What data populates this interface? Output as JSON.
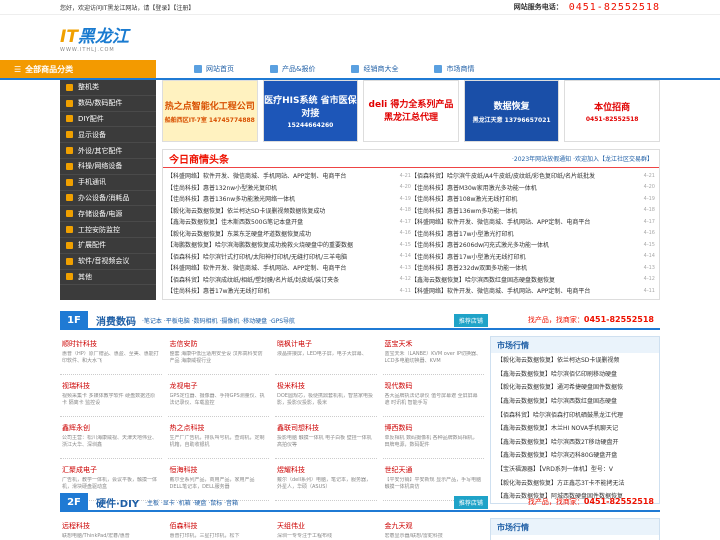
{
  "topbar": {
    "welcome": "您好，欢迎访问IT黑龙江网站，请【登录】【注册】",
    "hotline_label": "网站服务电话：",
    "hotline_number": "0451-82552518"
  },
  "logo": {
    "it": "IT",
    "name": "黑龙江",
    "url": "WWW.ITHLJ.COM"
  },
  "nav": {
    "category": "全部商品分类",
    "links": [
      "网站首页",
      "产品&报价",
      "经销商大全",
      "市场商情"
    ]
  },
  "sidebar": {
    "items": [
      "整机类",
      "数码/数码配件",
      "DIY配件",
      "显示设备",
      "外设/其它配件",
      "科操/网络设备",
      "手机通讯",
      "办公设备/消耗品",
      "存储设备/电源",
      "工控安防监控",
      "扩展配件",
      "软件/音视频会议",
      "其他"
    ]
  },
  "banners": [
    {
      "title": "热之点智能化工程公司",
      "sub": "船舶西区IT-7室 14745774888",
      "bg": "#fff2c0",
      "color": "#d85000"
    },
    {
      "title": "医疗HIS系统 省市医保对接",
      "sub": "15244664260",
      "bg": "#1d56b8",
      "color": "#ffffff"
    },
    {
      "title": "deli 得力全系列产品 黑龙江总代理",
      "sub": "",
      "bg": "#ffffff",
      "color": "#e10000"
    },
    {
      "title": "数据恢复",
      "sub": "黑龙江天意 13796657021",
      "bg": "#1a4fa8",
      "color": "#ffffff"
    },
    {
      "title": "本位招商",
      "sub": "0451-82552518",
      "bg": "#ffffff",
      "color": "#e10000"
    }
  ],
  "news": {
    "title": "今日商情头条",
    "notice": "·2023年网站放假通知 ·欢迎加入【龙江社区交易群】",
    "left": [
      [
        "【科盛网络】软件开发、微信商城、手机网站、APP定制、电商平台",
        "4-21"
      ],
      [
        "【佳尚科技】惠普132nw小型激光复印机",
        "4-20"
      ],
      [
        "【佳尚科技】惠普136nw多功能激光网络一体机",
        "4-19"
      ],
      [
        "【毅化海云数据恢复】依兰柯达SD卡误删视频数据恢复成功",
        "4-18"
      ],
      [
        "【鑫海云数据恢复】佳木斯西数500G笔记本盘开盘",
        "4-17"
      ],
      [
        "【毅化海云数据恢复】东莱东芝硬盘坏道数据恢复成功",
        "4-16"
      ],
      [
        "【海鹏数据恢复】哈尔滨海鹏数据恢复成功挽救火烧硬盘中的重要数据",
        "4-15"
      ],
      [
        "【佰森科技】哈尔滨针式打印机/太阳神打印机/无缝打印机/三羊电脑",
        "4-14"
      ],
      [
        "【科盛网络】软件开发、微信商城、手机网站、APP定制、电商平台",
        "4-13"
      ],
      [
        "【佰森科贸】哈尔滨成纹纸/相纸/塑封膜/名片纸/封皮纸/装订夹条",
        "4-12"
      ],
      [
        "【佳尚科技】惠普17w激光无线打印机",
        "4-11"
      ]
    ],
    "right": [
      [
        "【佰森科贸】哈尔滨牛皮纸/A4牛皮纸/皮纹纸/彩色复印纸/名片纸批发",
        "4-21"
      ],
      [
        "【佳尚科技】惠普M30w家用激光多功能一体机",
        "4-20"
      ],
      [
        "【佳尚科技】惠普108w激光无线打印机",
        "4-19"
      ],
      [
        "【佳尚科技】惠普136wm多功能一体机",
        "4-18"
      ],
      [
        "【科盛网络】软件开发、微信商城、手机网站、APP定制、电商平台",
        "4-17"
      ],
      [
        "【佳尚科技】惠普17w小型激光打印机",
        "4-16"
      ],
      [
        "【佳尚科技】惠普2606dw闪充式激光多功能一体机",
        "4-15"
      ],
      [
        "【佳尚科技】惠普17w小型激光无线打印机",
        "4-14"
      ],
      [
        "【佳尚科技】惠普232dw双面多功能一体机",
        "4-13"
      ],
      [
        "【鑫海云数据恢复】哈尔滨西数红盘固态硬盘数据恢复",
        "4-12"
      ],
      [
        "【科盛网络】软件开发、微信商城、手机网站、APP定制、电商平台",
        "4-11"
      ]
    ]
  },
  "floor1": {
    "num": "1F",
    "title": "消费数码",
    "sub": "·笔记本 ·平板电脑 ·数码相机 ·摄像机 ·移动硬盘 ·GPS导航",
    "badge": "推荐店铺",
    "hotline_label": "找产品，找商家：",
    "hotline": "0451-82552518",
    "cells": [
      {
        "name": "顺时针科技",
        "desc": "惠普（HP）原厂赠品、惠盈、至美、惠能打印软件、和大水飞"
      },
      {
        "name": "志信安防",
        "desc": "整套 海康中低压适用安全设 汉邦高科安防产品 海康威视行业"
      },
      {
        "name": "晓枫计电子",
        "desc": "液晶拼接屏，LED电子屏，电子大屏幕、"
      },
      {
        "name": "蓝宝天禾",
        "desc": "蓝宝天禾（LANBE）KVM over IP切换器、LCD多电脑切换器、KVM"
      },
      {
        "name": "视瑞科技",
        "desc": "视频采集卡 多媒体教学软件 硬盘数据还原卡 隔离卡 监控设"
      },
      {
        "name": "龙视电子",
        "desc": "GPS定位器、摄像器、手持GPS测量仪、执法记录仪、车载监控"
      },
      {
        "name": "极米科技",
        "desc": "DOE圆规芯，极便携鼎套机机，智慧家电投影，投影仪投影，极米"
      },
      {
        "name": "现代数码",
        "desc": "各大品牌执法记录仪 值号屏幕遮 全屏屏幕遮 时讯机 智能手写"
      },
      {
        "name": "鑫辉永创",
        "desc": "公司主营：松川海康威视、天津天地伟业、浙江大华、深圳鑫"
      },
      {
        "name": "热之点科技",
        "desc": "生产厂广告机，排队叫号机，查询机，定制机箱，自助收银机"
      },
      {
        "name": "鑫联司想科技",
        "desc": "投影电脑 触摸一体机 电子白板 壁挂一体机 高拍仪等"
      },
      {
        "name": "博西数码",
        "desc": "单反相机 数码摄像机 各种品牌数码相机，田牌电源，数码配件"
      },
      {
        "name": "汇聚成电子",
        "desc": "广告机，教学一体机，会议平板，触摸一体机，滑块硬盘驱动盒"
      },
      {
        "name": "恒海科技",
        "desc": "戴尔全系列产品，商用产品，家用产品 DELL笔记本，DELL服务器"
      },
      {
        "name": "煜耀科技",
        "desc": "戴尔（dell系列）电脑，笔记本，服务器，外星人，华硕（ASUS）"
      },
      {
        "name": "世纪天通",
        "desc": "【平安分销】平安新规 显示产品，手写电脑 触摸一体机高仿"
      }
    ],
    "market_title": "市场行情",
    "market": [
      "【毅化海云数据恢复】依兰柯达SD卡误删视频",
      "【鑫海云数据恢复】哈尔滨佰亿印刷移动硬盘",
      "【毅化海云数据恢复】通河希捷硬盘固件数据恢",
      "【鑫海云数据恢复】哈尔滨西数红盘固态硬盘",
      "【佰森科贸】哈尔滨佰森打印机硒鼓黑龙江代理",
      "【鑫海云数据恢复】木兰HI NOVA手机聊天记",
      "【鑫海云数据恢复】哈尔滨西数2T移动硬盘开",
      "【鑫海云数据恢复】哈尔滨迈科80G硬盘开盘",
      "【宝沃福源器】【VRD系列一体机】型号：V",
      "【毅化海云数据恢复】方正鑫芯3T卡不能拷无法",
      "【鑫海云数据恢复】阿城西数硬盘固件数据恢复"
    ]
  },
  "floor2": {
    "num": "2F",
    "title": "硬件·DIY",
    "sub": "·主板 ·显卡 ·机箱 ·硬盘 ·鼠标 ·音箱",
    "badge": "推荐店铺",
    "hotline_label": "找产品，找商家：",
    "hotline": "0451-82552518",
    "cells": [
      {
        "name": "远程科技",
        "desc": "联想电脑/ThinkPad/宏碁/惠普"
      },
      {
        "name": "佰森科技",
        "desc": "惠普打印机，三星打印机，松下"
      },
      {
        "name": "天组伟业",
        "desc": "深圳一专专注于工程布线"
      },
      {
        "name": "金九天观",
        "desc": "宏碁显示器/联想/雷蛇科技"
      }
    ],
    "market_title": "市场行情"
  }
}
